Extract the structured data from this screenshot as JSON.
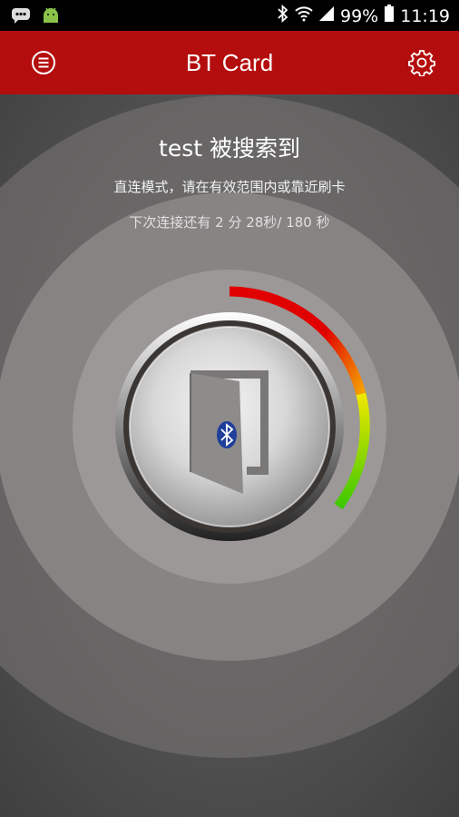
{
  "status_bar": {
    "battery": "99%",
    "time": "11:19",
    "icons": [
      "message-icon",
      "android-icon",
      "bluetooth-icon",
      "wifi-icon",
      "signal-icon",
      "battery-icon"
    ]
  },
  "app_bar": {
    "title": "BT Card",
    "menu_icon": "menu-icon",
    "settings_icon": "gear-icon"
  },
  "main": {
    "device_title": "test 被搜索到",
    "mode_text": "直连模式，请在有效范围内或靠近刷卡",
    "countdown": {
      "prefix": "下次连接还有",
      "minutes": "2",
      "minute_unit": "分",
      "seconds": "28",
      "second_unit": "秒",
      "total": "/ 180",
      "total_unit": "秒"
    },
    "progress_fraction": 0.82,
    "door_icon": "door-icon",
    "bluetooth_badge": "bluetooth-icon"
  },
  "colors": {
    "app_bar": "#b40d0d",
    "status_bar": "#000000",
    "ring_red": "#e00000",
    "ring_yellow": "#f0e800",
    "ring_green": "#3cc800",
    "bluetooth_badge": "#1f3f9a"
  }
}
